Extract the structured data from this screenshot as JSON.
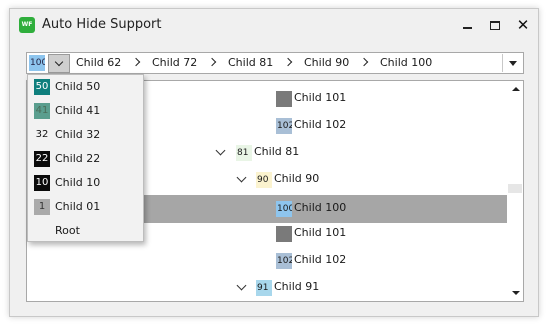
{
  "window": {
    "title": "Auto Hide Support",
    "app_icon_text": "WF"
  },
  "breadcrumb": {
    "current": {
      "text": "100",
      "color": "#8ec5ee"
    },
    "items": [
      "Child 62",
      "Child 72",
      "Child 81",
      "Child 90",
      "Child 100"
    ]
  },
  "tree": {
    "rows": [
      {
        "icon_text": "",
        "icon_color": "#7a7a7a",
        "label": "Child 101",
        "has_chevron": false
      },
      {
        "icon_text": "102",
        "icon_color": "#a9bfd6",
        "label": "Child 102",
        "has_chevron": false
      },
      {
        "icon_text": "81",
        "icon_color": "#e9f5e6",
        "label": "Child 81",
        "has_chevron": true
      },
      {
        "icon_text": "90",
        "icon_color": "#fbf3cf",
        "label": "Child 90",
        "has_chevron": true
      },
      {
        "icon_text": "100",
        "icon_color": "#8ec5ee",
        "label": "Child 100",
        "has_chevron": false,
        "selected": true
      },
      {
        "icon_text": "",
        "icon_color": "#7a7a7a",
        "label": "Child 101",
        "has_chevron": false
      },
      {
        "icon_text": "102",
        "icon_color": "#a9bfd6",
        "label": "Child 102",
        "has_chevron": false
      },
      {
        "icon_text": "91",
        "icon_color": "#a8d7ec",
        "label": "Child 91",
        "has_chevron": true
      }
    ]
  },
  "popup": {
    "items": [
      {
        "icon_text": "50",
        "icon_bg": "#0f7f7d",
        "icon_fg": "#ffffff",
        "label": "Child 50"
      },
      {
        "icon_text": "41",
        "icon_bg": "#5a9e8e",
        "icon_fg": "#4a6e5a",
        "label": "Child 41"
      },
      {
        "icon_text": "32",
        "icon_bg": "transparent",
        "icon_fg": "#111111",
        "label": "Child 32"
      },
      {
        "icon_text": "22",
        "icon_bg": "#0a0a0a",
        "icon_fg": "#ffffff",
        "label": "Child 22"
      },
      {
        "icon_text": "10",
        "icon_bg": "#0a0a0a",
        "icon_fg": "#ffffff",
        "label": "Child 10"
      },
      {
        "icon_text": "1",
        "icon_bg": "#aaaaaa",
        "icon_fg": "#333333",
        "label": "Child 01"
      },
      {
        "icon_text": "",
        "icon_bg": "transparent",
        "icon_fg": "#111111",
        "label": "Root"
      }
    ]
  }
}
